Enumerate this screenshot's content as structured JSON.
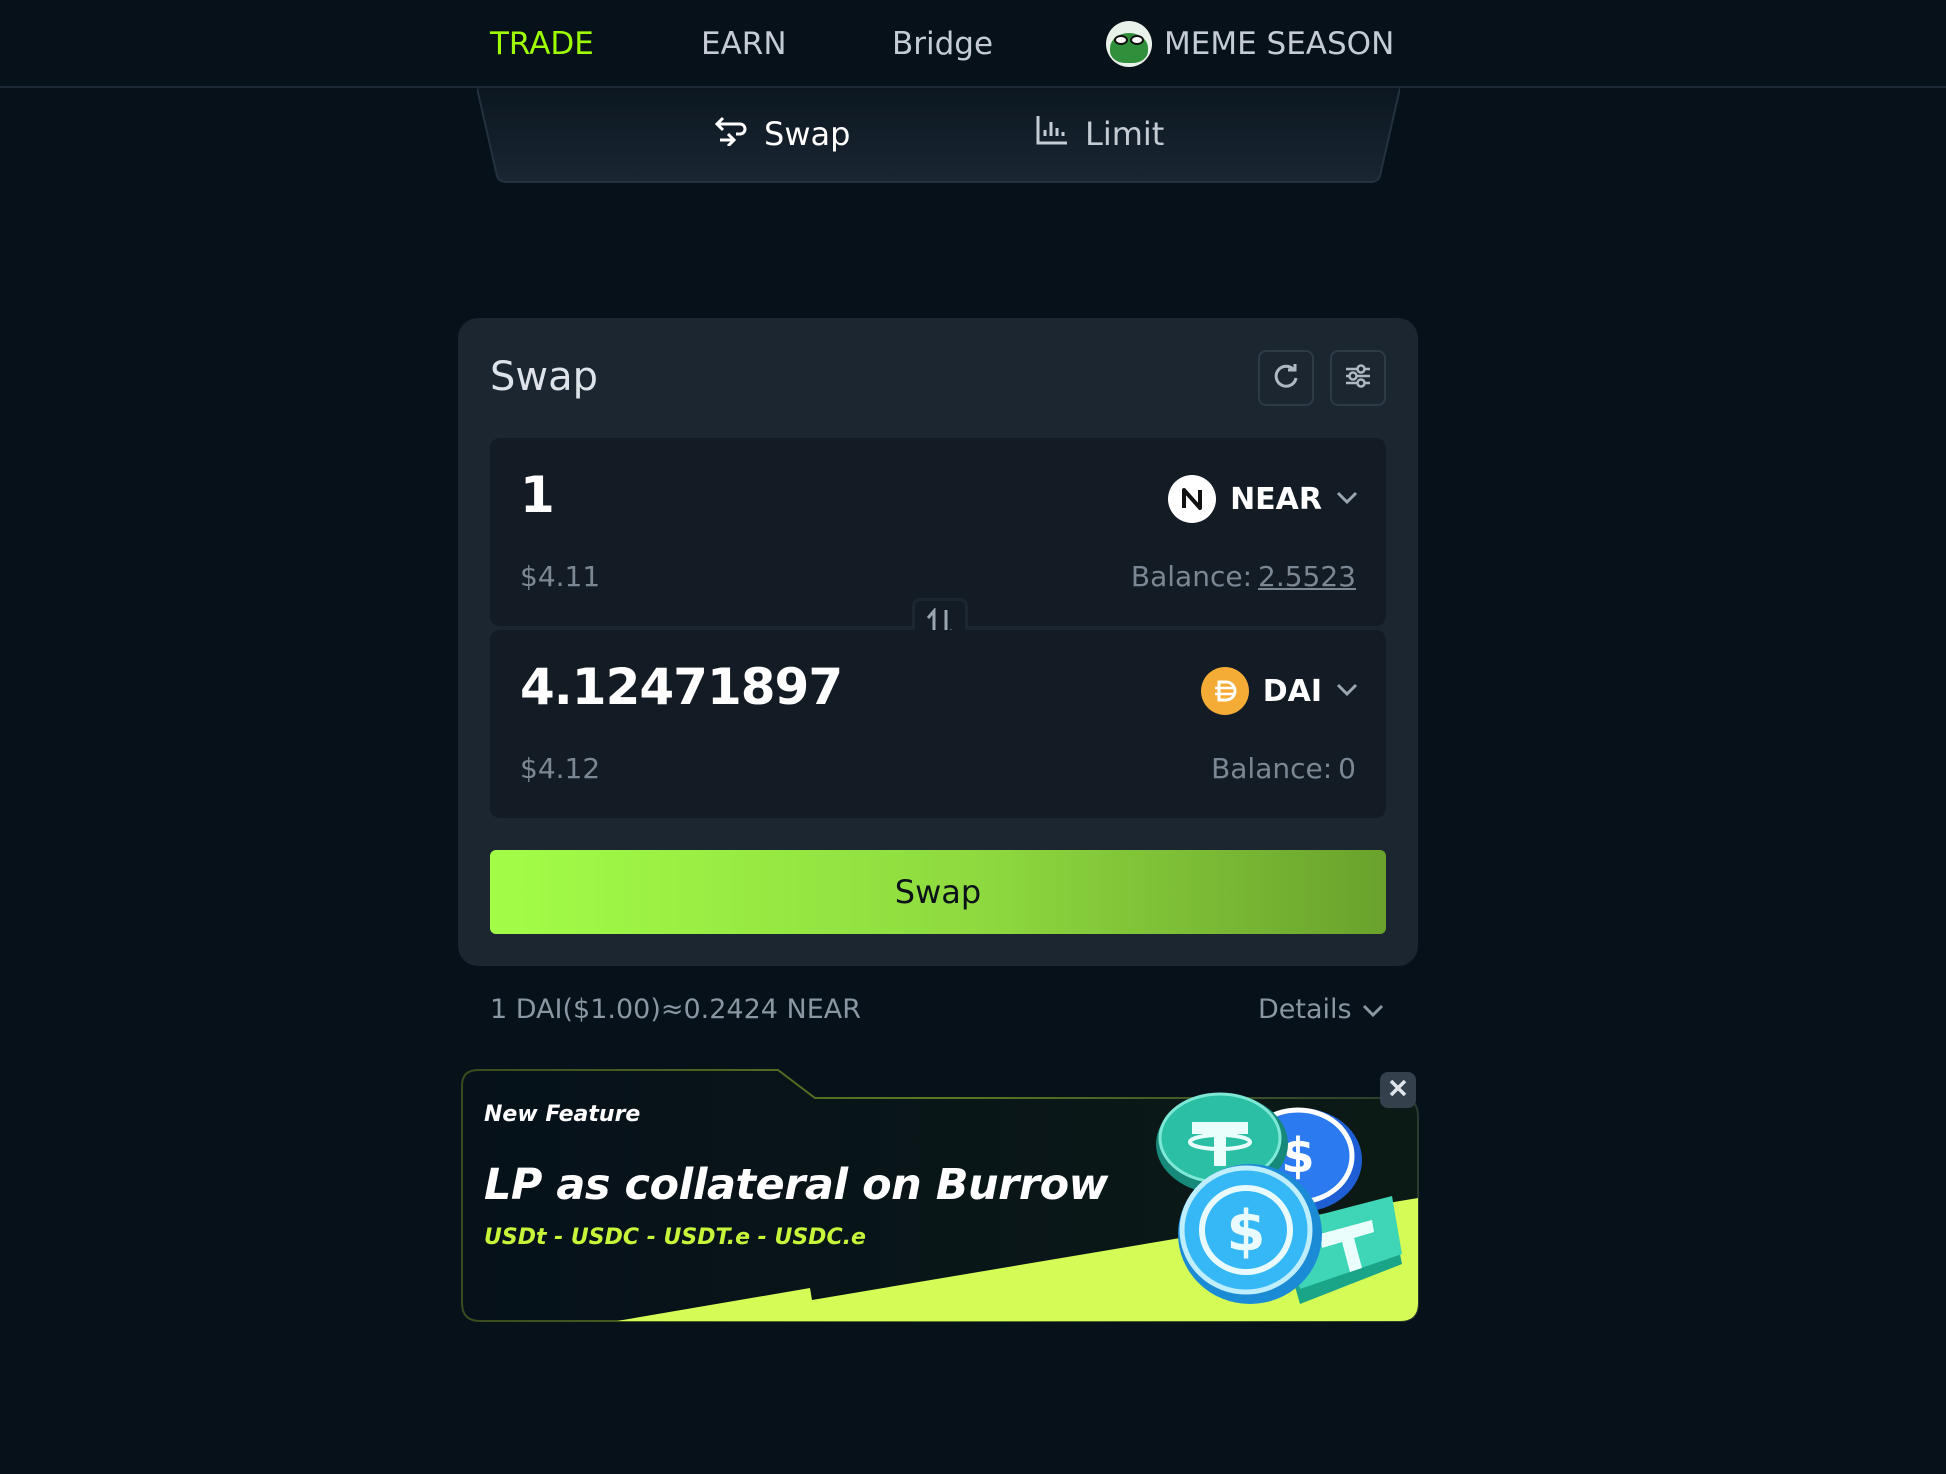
{
  "nav": {
    "items": [
      {
        "label": "TRADE",
        "active": true
      },
      {
        "label": "EARN",
        "active": false
      },
      {
        "label": "Bridge",
        "active": false
      },
      {
        "label": "MEME SEASON",
        "active": false
      }
    ]
  },
  "subtabs": {
    "swap_label": "Swap",
    "limit_label": "Limit"
  },
  "card": {
    "title": "Swap",
    "from": {
      "amount": "1",
      "usd": "$4.11",
      "token": "NEAR",
      "balance_label": "Balance:",
      "balance_value": "2.5523"
    },
    "to": {
      "amount": "4.12471897",
      "usd": "$4.12",
      "token": "DAI",
      "balance_label": "Balance:",
      "balance_value": "0"
    },
    "swap_button": "Swap"
  },
  "rate": "1 DAI($1.00)≈0.2424 NEAR",
  "details_label": "Details",
  "banner": {
    "tag": "New Feature",
    "headline": "LP as collateral on Burrow",
    "sub": "USDt - USDC - USDT.e - USDC.e"
  },
  "colors": {
    "accent": "#9efe01",
    "background": "#06111a",
    "card": "#1b2631",
    "dai": "#f5ac37"
  }
}
